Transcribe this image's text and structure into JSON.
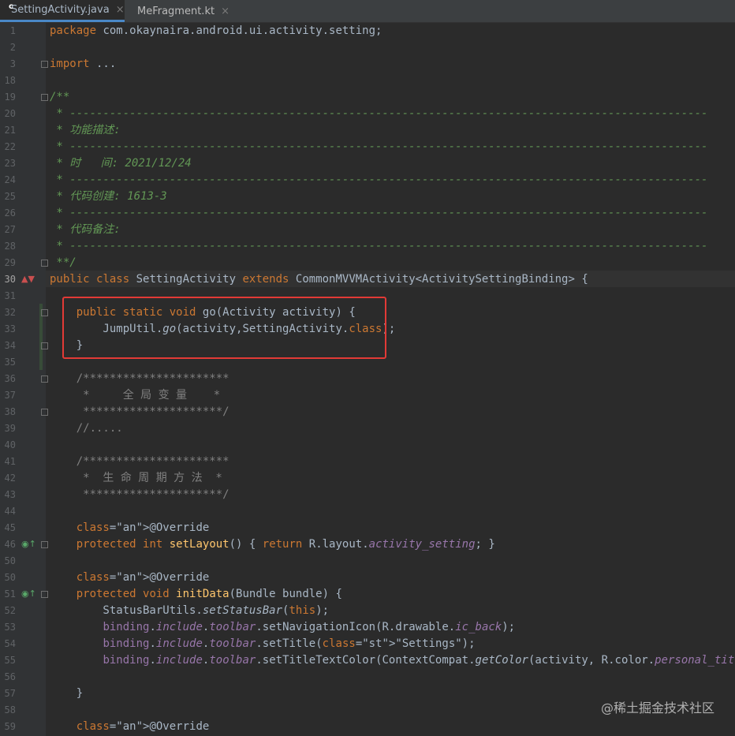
{
  "tabs": [
    {
      "label": "SettingActivity.java",
      "icon": "java-class-icon",
      "active": true
    },
    {
      "label": "MeFragment.kt",
      "icon": "kotlin-file-icon",
      "active": false
    }
  ],
  "close_glyph": "×",
  "lines": [
    {
      "n": "1",
      "t": "package com.okaynaira.android.ui.activity.setting;"
    },
    {
      "n": "2",
      "t": ""
    },
    {
      "n": "3",
      "t": "import ..."
    },
    {
      "n": "18",
      "t": ""
    },
    {
      "n": "19",
      "t": "/**"
    },
    {
      "n": "20",
      "t": " * ------------------------------------------------------------------------------------------------"
    },
    {
      "n": "21",
      "t": " * 功能描述:"
    },
    {
      "n": "22",
      "t": " * ------------------------------------------------------------------------------------------------"
    },
    {
      "n": "23",
      "t": " * 时   间: 2021/12/24"
    },
    {
      "n": "24",
      "t": " * ------------------------------------------------------------------------------------------------"
    },
    {
      "n": "25",
      "t": " * 代码创建: 1613-3"
    },
    {
      "n": "26",
      "t": " * ------------------------------------------------------------------------------------------------"
    },
    {
      "n": "27",
      "t": " * 代码备注:"
    },
    {
      "n": "28",
      "t": " * ------------------------------------------------------------------------------------------------"
    },
    {
      "n": "29",
      "t": " **/"
    },
    {
      "n": "30",
      "t": "public class SettingActivity extends CommonMVVMActivity<ActivitySettingBinding> {"
    },
    {
      "n": "31",
      "t": ""
    },
    {
      "n": "32",
      "t": "    public static void go(Activity activity) {"
    },
    {
      "n": "33",
      "t": "        JumpUtil.go(activity,SettingActivity.class);"
    },
    {
      "n": "34",
      "t": "    }"
    },
    {
      "n": "35",
      "t": ""
    },
    {
      "n": "36",
      "t": "    /**********************"
    },
    {
      "n": "37",
      "t": "     *     全 局 变 量    *"
    },
    {
      "n": "38",
      "t": "     *********************/"
    },
    {
      "n": "39",
      "t": "    //....."
    },
    {
      "n": "40",
      "t": ""
    },
    {
      "n": "41",
      "t": "    /**********************"
    },
    {
      "n": "42",
      "t": "     *  生 命 周 期 方 法  *"
    },
    {
      "n": "43",
      "t": "     *********************/"
    },
    {
      "n": "44",
      "t": ""
    },
    {
      "n": "45",
      "t": "    @Override"
    },
    {
      "n": "46",
      "t": "    protected int setLayout() { return R.layout.activity_setting; }"
    },
    {
      "n": "50",
      "t": ""
    },
    {
      "n": "50b",
      "t": "    @Override"
    },
    {
      "n": "51",
      "t": "    protected void initData(Bundle bundle) {"
    },
    {
      "n": "52",
      "t": "        StatusBarUtils.setStatusBar(this);"
    },
    {
      "n": "53",
      "t": "        binding.include.toolbar.setNavigationIcon(R.drawable.ic_back);"
    },
    {
      "n": "54",
      "t": "        binding.include.toolbar.setTitle(\"Settings\");"
    },
    {
      "n": "55",
      "t": "        binding.include.toolbar.setTitleTextColor(ContextCompat.getColor(activity, R.color.personal_title));"
    },
    {
      "n": "56",
      "t": ""
    },
    {
      "n": "57",
      "t": "    }"
    },
    {
      "n": "58",
      "t": ""
    },
    {
      "n": "59",
      "t": "    @Override"
    }
  ],
  "gutter_numbers": [
    "1",
    "2",
    "3",
    "18",
    "19",
    "20",
    "21",
    "22",
    "23",
    "24",
    "25",
    "26",
    "27",
    "28",
    "29",
    "30",
    "31",
    "32",
    "33",
    "34",
    "35",
    "36",
    "37",
    "38",
    "39",
    "40",
    "41",
    "42",
    "43",
    "44",
    "45",
    "46",
    "50",
    "50",
    "51",
    "52",
    "53",
    "54",
    "55",
    "56",
    "57",
    "58",
    "59"
  ],
  "watermark": "@稀土掘金技术社区",
  "colors": {
    "keyword": "#cc7832",
    "comment": "#629755",
    "annotation": "#bbb529",
    "string": "#6a8759",
    "field": "#9876aa",
    "method": "#ffc66d",
    "highlight_box": "#e23a36"
  }
}
